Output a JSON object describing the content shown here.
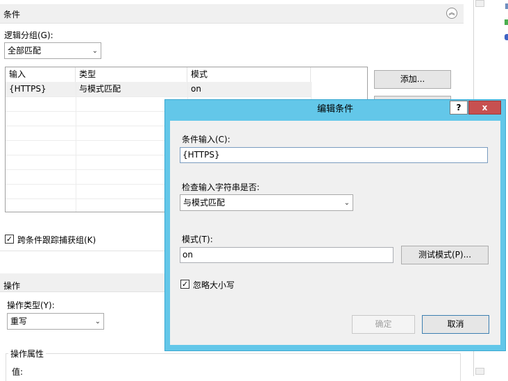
{
  "conditions_section": {
    "title": "条件",
    "collapse_glyph": "︽",
    "logical_group_label": "逻辑分组(G):",
    "logical_group_value": "全部匹配",
    "columns": [
      "输入",
      "类型",
      "模式"
    ],
    "rows": [
      {
        "input": "{HTTPS}",
        "type": "与模式匹配",
        "pattern": "on"
      }
    ],
    "add_button": "添加...",
    "track_capture_label": "跨条件跟踪捕获组(K)",
    "track_capture_checked": true
  },
  "action_section": {
    "title": "操作",
    "action_type_label": "操作类型(Y):",
    "action_type_value": "重写",
    "action_props_label": "操作属性",
    "value_label": "值:"
  },
  "dialog": {
    "title": "编辑条件",
    "help": "?",
    "close": "x",
    "condition_input_label": "条件输入(C):",
    "condition_input_value": "{HTTPS}",
    "check_input_label": "检查输入字符串是否:",
    "check_input_value": "与模式匹配",
    "pattern_label": "模式(T):",
    "pattern_value": "on",
    "test_pattern_button": "测试模式(P)...",
    "ignore_case_label": "忽略大小写",
    "ignore_case_checked": true,
    "ok_button": "确定",
    "cancel_button": "取消"
  },
  "icons": {
    "dropdown": "chevron-down-icon",
    "check": "checkmark-icon"
  },
  "colors": {
    "dialog_frame": "#63c7e9",
    "close_button": "#c75050",
    "body_bg": "#f0f0f0"
  }
}
